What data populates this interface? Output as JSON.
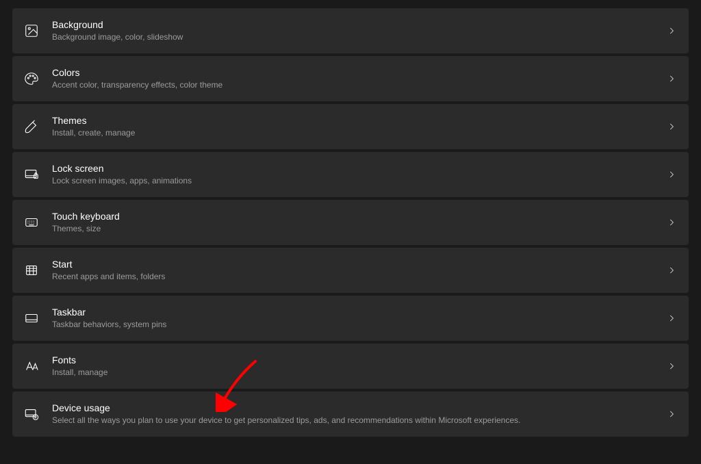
{
  "settings": {
    "items": [
      {
        "key": "background",
        "title": "Background",
        "description": "Background image, color, slideshow"
      },
      {
        "key": "colors",
        "title": "Colors",
        "description": "Accent color, transparency effects, color theme"
      },
      {
        "key": "themes",
        "title": "Themes",
        "description": "Install, create, manage"
      },
      {
        "key": "lock-screen",
        "title": "Lock screen",
        "description": "Lock screen images, apps, animations"
      },
      {
        "key": "touch-keyboard",
        "title": "Touch keyboard",
        "description": "Themes, size"
      },
      {
        "key": "start",
        "title": "Start",
        "description": "Recent apps and items, folders"
      },
      {
        "key": "taskbar",
        "title": "Taskbar",
        "description": "Taskbar behaviors, system pins"
      },
      {
        "key": "fonts",
        "title": "Fonts",
        "description": "Install, manage"
      },
      {
        "key": "device-usage",
        "title": "Device usage",
        "description": "Select all the ways you plan to use your device to get personalized tips, ads, and recommendations within Microsoft experiences."
      }
    ]
  },
  "annotation": {
    "arrow_color": "#ff0000",
    "points_to": "device-usage"
  }
}
